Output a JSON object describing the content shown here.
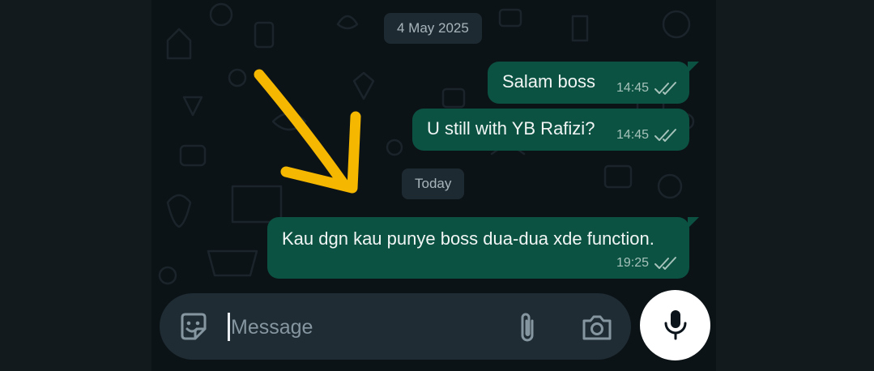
{
  "chat": {
    "dates": [
      "4 May 2025",
      "Today"
    ],
    "messages": [
      {
        "text": "Salam boss",
        "time": "14:45",
        "status": "read"
      },
      {
        "text": "U still with YB Rafizi?",
        "time": "14:45",
        "status": "read"
      },
      {
        "text": "Kau dgn kau punye boss dua-dua xde function.",
        "time": "19:25",
        "status": "read"
      }
    ]
  },
  "composer": {
    "placeholder": "Message",
    "value": "",
    "icons": [
      "emoji-sticker-icon",
      "paperclip-icon",
      "camera-icon",
      "microphone-icon"
    ]
  },
  "annotation": {
    "type": "hand-drawn arrow",
    "color": "#f5b700"
  },
  "colors": {
    "background": "#0c1317",
    "outgoing_bubble": "#0b5242",
    "date_chip": "#1e2a31",
    "composer": "#1f2c34",
    "read_ticks": "#a6c2ba"
  }
}
